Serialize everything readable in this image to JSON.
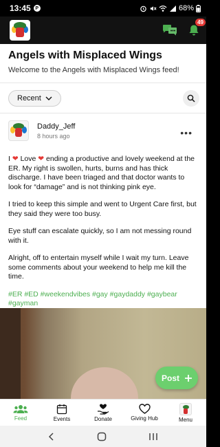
{
  "status_bar": {
    "time": "13:45",
    "status_icon": "P",
    "battery": "68%"
  },
  "header": {
    "logo_icon": "angels-logo-icon",
    "notification_count": "49"
  },
  "feed": {
    "title": "Angels with Misplaced Wings",
    "subtitle": "Welcome to the Angels with Misplaced Wings feed!",
    "filter_label": "Recent"
  },
  "post": {
    "author": "Daddy_Jeff",
    "time": "8 hours ago",
    "line1_a": "I",
    "line1_b": "Love",
    "line1_c": "ending a productive and lovely weekend at the ER.  My right is swollen, hurts, burns and has thick discharge. I have been triaged and that doctor wants to look for “damage” and is not thinking pink eye.",
    "p2": "I tried to keep this simple and went to Urgent Care first, but they said they were too busy.",
    "p3": "Eye stuff can escalate quickly, so I am not messing round with it.",
    "p4": "Alright, off to entertain myself while I wait my turn. Leave some comments about your weekend to help me kill the time.",
    "hashtags": "#ER #ED #weekendvibes #gay #gaydaddy #gaybear #gayman"
  },
  "fab": {
    "label": "Post"
  },
  "bottom_nav": {
    "items": [
      {
        "label": "Feed",
        "icon": "people-icon"
      },
      {
        "label": "Events",
        "icon": "calendar-icon"
      },
      {
        "label": "Donate",
        "icon": "donate-heart-hand-icon"
      },
      {
        "label": "Giving Hub",
        "icon": "heart-icon"
      },
      {
        "label": "Menu",
        "icon": "menu-logo-icon"
      }
    ]
  },
  "colors": {
    "accent": "#4caf50",
    "badge": "#e53935",
    "fab": "#6ccf6e"
  }
}
